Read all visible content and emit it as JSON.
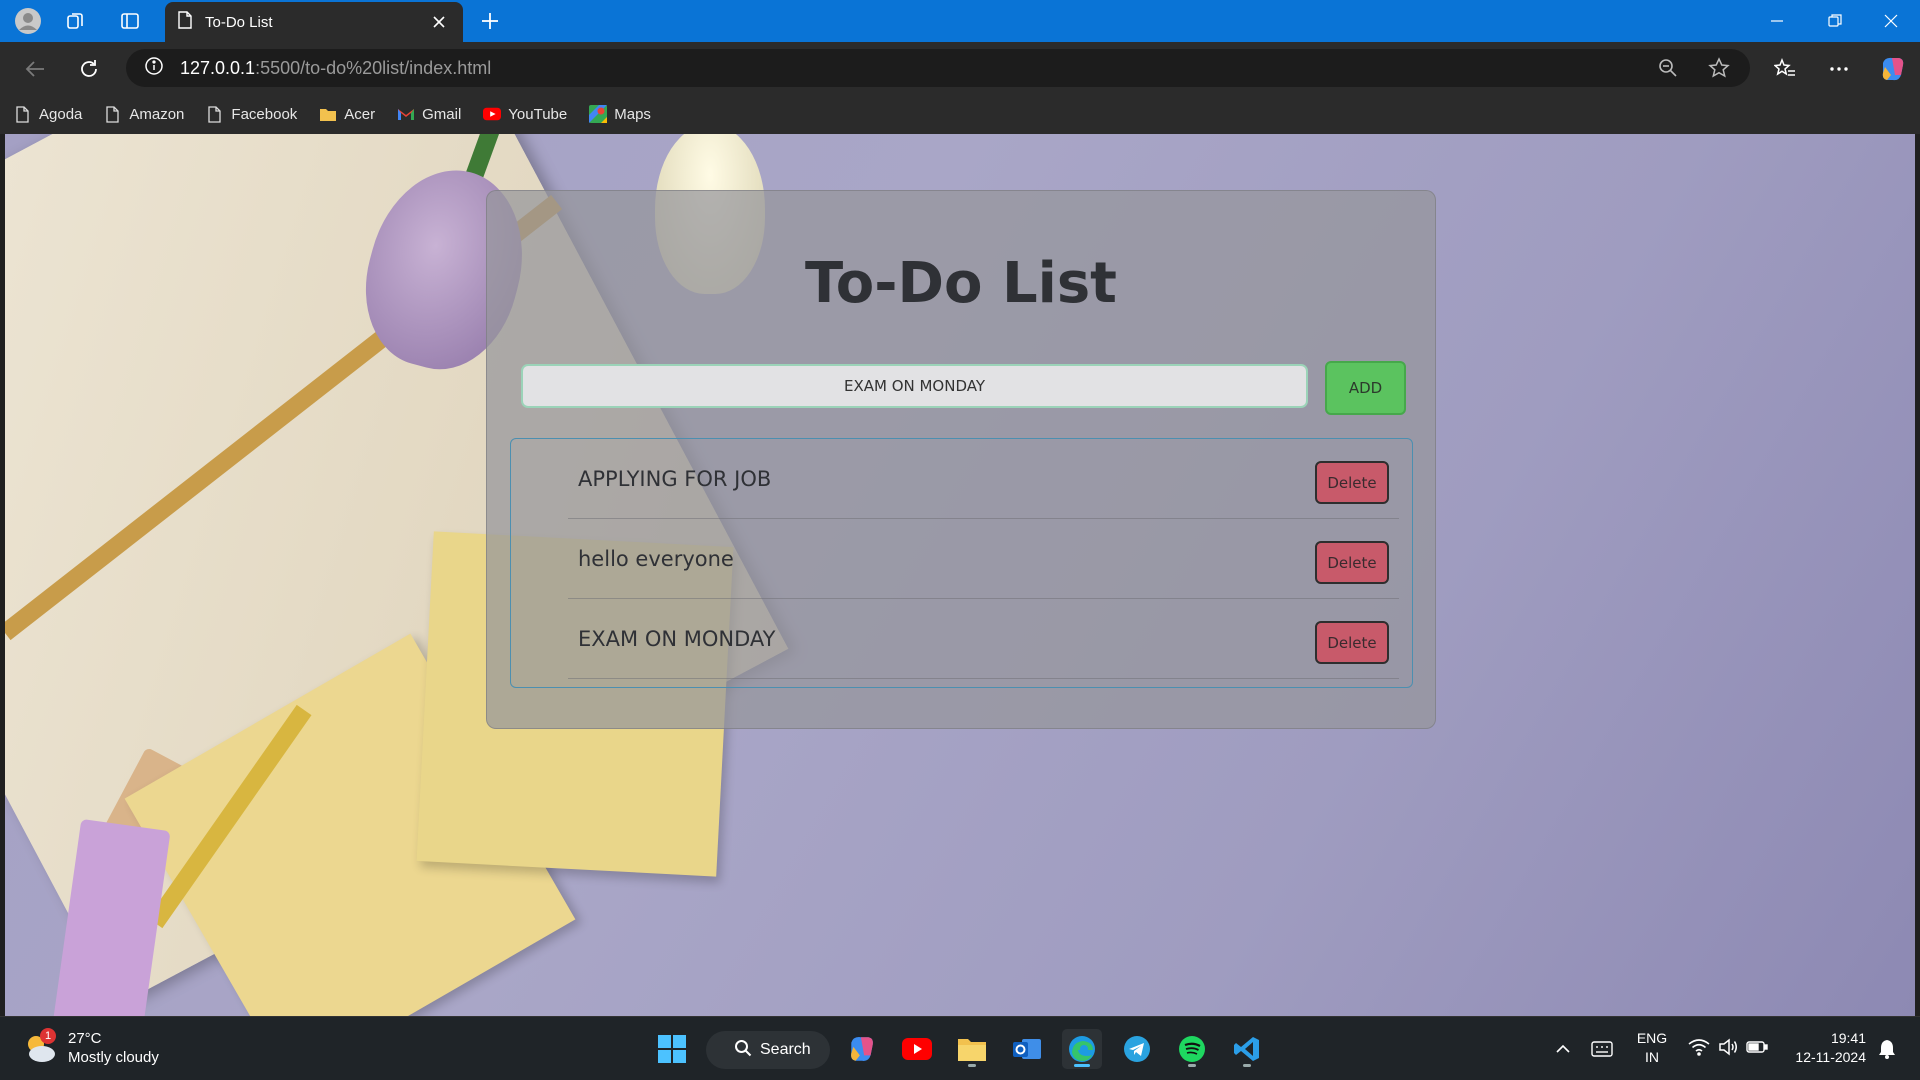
{
  "browser": {
    "tab_title": "To-Do List",
    "url_host": "127.0.0.1",
    "url_path": ":5500/to-do%20list/index.html",
    "bookmarks": [
      {
        "label": "Agoda",
        "icon": "page-icon"
      },
      {
        "label": "Amazon",
        "icon": "page-icon"
      },
      {
        "label": "Facebook",
        "icon": "page-icon"
      },
      {
        "label": "Acer",
        "icon": "folder-icon"
      },
      {
        "label": "Gmail",
        "icon": "gmail-icon"
      },
      {
        "label": "YouTube",
        "icon": "youtube-icon"
      },
      {
        "label": "Maps",
        "icon": "maps-icon"
      }
    ]
  },
  "app": {
    "title": "To-Do List",
    "input_value": "EXAM ON MONDAY",
    "add_label": "ADD",
    "tasks": [
      {
        "text": "APPLYING FOR JOB",
        "delete_label": "Delete"
      },
      {
        "text": "hello everyone",
        "delete_label": "Delete"
      },
      {
        "text": "EXAM ON MONDAY",
        "delete_label": "Delete"
      }
    ]
  },
  "taskbar": {
    "weather_badge": "1",
    "temperature": "27°C",
    "condition": "Mostly cloudy",
    "search_label": "Search",
    "lang_line1": "ENG",
    "lang_line2": "IN",
    "time": "19:41",
    "date": "12-11-2024"
  },
  "colors": {
    "titlebar": "#0a74d6",
    "add_button": "#5bc35f",
    "delete_button": "#c85a6a"
  }
}
